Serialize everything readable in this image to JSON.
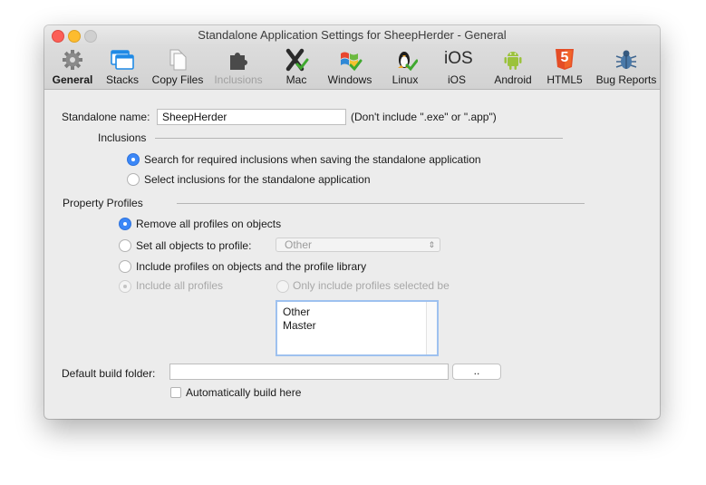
{
  "window": {
    "title": "Standalone Application Settings for SheepHerder - General"
  },
  "toolbar": [
    {
      "label": "General",
      "icon": "gear-icon",
      "state": "active"
    },
    {
      "label": "Stacks",
      "icon": "stacks-icon",
      "state": "normal"
    },
    {
      "label": "Copy Files",
      "icon": "copy-files-icon",
      "state": "normal"
    },
    {
      "label": "Inclusions",
      "icon": "puzzle-icon",
      "state": "disabled"
    },
    {
      "label": "Mac",
      "icon": "mac-x-icon",
      "state": "normal"
    },
    {
      "label": "Windows",
      "icon": "windows-flag-icon",
      "state": "normal"
    },
    {
      "label": "Linux",
      "icon": "linux-penguin-icon",
      "state": "normal"
    },
    {
      "label": "iOS",
      "icon": "ios-text-icon",
      "icon_text": "iOS",
      "state": "normal"
    },
    {
      "label": "Android",
      "icon": "android-icon",
      "state": "normal"
    },
    {
      "label": "HTML5",
      "icon": "html5-icon",
      "icon_text": "5",
      "state": "normal"
    },
    {
      "label": "Bug Reports",
      "icon": "bug-icon",
      "state": "normal"
    }
  ],
  "general": {
    "standalone_name_label": "Standalone name:",
    "standalone_name_value": "SheepHerder",
    "standalone_name_hint": "(Don't include \".exe\" or \".app\")",
    "inclusions_heading": "Inclusions",
    "inclusions_search": "Search for required inclusions when saving the standalone application",
    "inclusions_select": "Select inclusions for the standalone application",
    "profiles_heading": "Property Profiles",
    "profiles_remove": "Remove all profiles on objects",
    "profiles_set_all": "Set all objects to profile:",
    "profiles_set_all_value": "Other",
    "profiles_include_library": "Include profiles on objects and the profile library",
    "profiles_include_all": "Include all profiles",
    "profiles_only_selected": "Only include profiles selected be",
    "profile_list": [
      "Other",
      "Master"
    ],
    "build_folder_label": "Default build folder:",
    "build_folder_value": "",
    "browse_button": "..",
    "auto_build": "Automatically build here"
  },
  "colors": {
    "accent": "#3b87f7",
    "close": "#fc5f57",
    "minimize": "#fdbc2e"
  }
}
